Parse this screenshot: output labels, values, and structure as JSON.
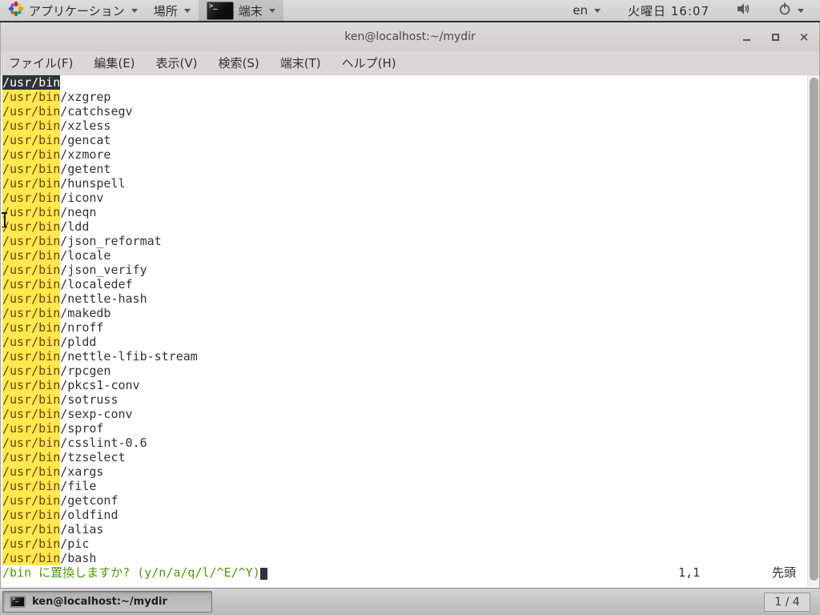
{
  "top_panel": {
    "applications_label": "アプリケーション",
    "places_label": "場所",
    "terminal_menu_label": "端末",
    "language": "en",
    "clock": "火曜日 16:07",
    "icons": {
      "applications": "distro-flower-icon",
      "terminal_menu": "terminal-window-icon",
      "volume": "speaker-icon",
      "power": "power-icon"
    }
  },
  "window": {
    "title": "ken@localhost:~/mydir",
    "buttons": {
      "minimize": "minimize",
      "maximize": "maximize",
      "close": "×"
    },
    "menubar": [
      "ファイル(F)",
      "編集(E)",
      "表示(V)",
      "検索(S)",
      "端末(T)",
      "ヘルプ(H)"
    ]
  },
  "terminal": {
    "lines": [
      {
        "match": "/usr/bin",
        "rest": "",
        "current": true
      },
      {
        "match": "/usr/bin",
        "rest": "/xzgrep"
      },
      {
        "match": "/usr/bin",
        "rest": "/catchsegv"
      },
      {
        "match": "/usr/bin",
        "rest": "/xzless"
      },
      {
        "match": "/usr/bin",
        "rest": "/gencat"
      },
      {
        "match": "/usr/bin",
        "rest": "/xzmore"
      },
      {
        "match": "/usr/bin",
        "rest": "/getent"
      },
      {
        "match": "/usr/bin",
        "rest": "/hunspell"
      },
      {
        "match": "/usr/bin",
        "rest": "/iconv"
      },
      {
        "match": "/usr/bin",
        "rest": "/neqn"
      },
      {
        "match": "/usr/bin",
        "rest": "/ldd"
      },
      {
        "match": "/usr/bin",
        "rest": "/json_reformat"
      },
      {
        "match": "/usr/bin",
        "rest": "/locale"
      },
      {
        "match": "/usr/bin",
        "rest": "/json_verify"
      },
      {
        "match": "/usr/bin",
        "rest": "/localedef"
      },
      {
        "match": "/usr/bin",
        "rest": "/nettle-hash"
      },
      {
        "match": "/usr/bin",
        "rest": "/makedb"
      },
      {
        "match": "/usr/bin",
        "rest": "/nroff"
      },
      {
        "match": "/usr/bin",
        "rest": "/pldd"
      },
      {
        "match": "/usr/bin",
        "rest": "/nettle-lfib-stream"
      },
      {
        "match": "/usr/bin",
        "rest": "/rpcgen"
      },
      {
        "match": "/usr/bin",
        "rest": "/pkcs1-conv"
      },
      {
        "match": "/usr/bin",
        "rest": "/sotruss"
      },
      {
        "match": "/usr/bin",
        "rest": "/sexp-conv"
      },
      {
        "match": "/usr/bin",
        "rest": "/sprof"
      },
      {
        "match": "/usr/bin",
        "rest": "/csslint-0.6"
      },
      {
        "match": "/usr/bin",
        "rest": "/tzselect"
      },
      {
        "match": "/usr/bin",
        "rest": "/xargs"
      },
      {
        "match": "/usr/bin",
        "rest": "/file"
      },
      {
        "match": "/usr/bin",
        "rest": "/getconf"
      },
      {
        "match": "/usr/bin",
        "rest": "/oldfind"
      },
      {
        "match": "/usr/bin",
        "rest": "/alias"
      },
      {
        "match": "/usr/bin",
        "rest": "/pic"
      },
      {
        "match": "/usr/bin",
        "rest": "/bash"
      }
    ],
    "prompt": "/bin に置換しますか? (y/n/a/q/l/^E/^Y)",
    "ruler": "1,1",
    "position_label": "先頭",
    "colors": {
      "search_highlight_bg": "#fce94f",
      "search_highlight_fg": "#7c3b05",
      "current_match_bg": "#2e3436",
      "current_match_fg": "#ffffff",
      "prompt_green": "#4e9a06",
      "terminal_fg": "#2e3436",
      "terminal_bg": "#ffffff"
    }
  },
  "taskbar": {
    "task_button_label": "ken@localhost:~/mydir",
    "workspace_indicator": "1 / 4"
  }
}
